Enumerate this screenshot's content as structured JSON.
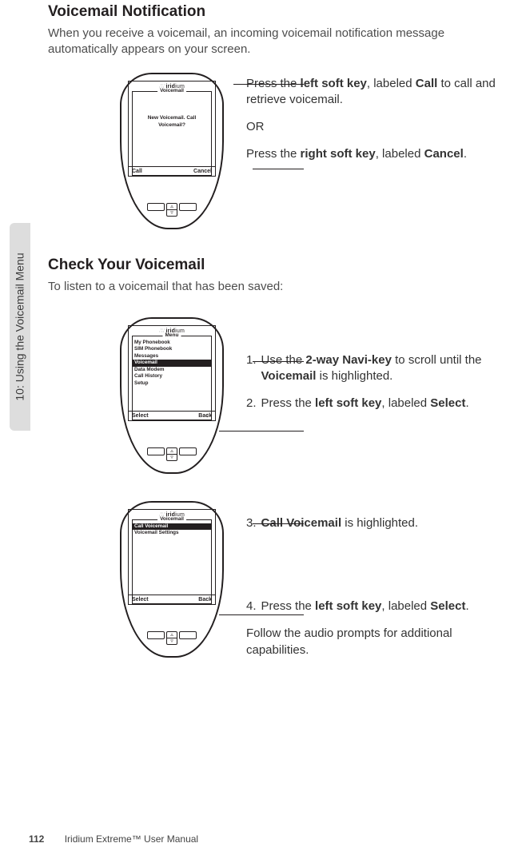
{
  "side_tab": "10: Using the Voicemail Menu",
  "section1": {
    "title": "Voicemail Notification",
    "intro": "When you receive a voicemail, an incoming voicemail notification message automatically appears on your screen.",
    "instr1_pre": "Press the ",
    "instr1_bold1": "left soft key",
    "instr1_mid": ", labeled ",
    "instr1_bold2": "Call",
    "instr1_post": " to call and retrieve voicemail.",
    "or": "OR",
    "instr2_pre": "Press the ",
    "instr2_bold1": "right soft key",
    "instr2_mid": ", labeled ",
    "instr2_bold2": "Cancel",
    "instr2_post": "."
  },
  "phone1": {
    "brand_word1": "irid",
    "brand_word2": "ium",
    "legend": "Voicemail",
    "prompt_l1": "New Voicemail. Call",
    "prompt_l2": "Voicemail?",
    "left_soft": "Call",
    "right_soft": "Cancel"
  },
  "section2": {
    "title": "Check Your Voicemail",
    "intro": "To listen to a voicemail that has been saved:",
    "step1_num": "1.",
    "step1_pre": "Use the ",
    "step1_bold1": "2-way Navi-key",
    "step1_mid": " to scroll until the ",
    "step1_bold2": "Voicemail",
    "step1_post": " is highlighted.",
    "step2_num": "2.",
    "step2_pre": "Press the ",
    "step2_bold1": "left soft key",
    "step2_mid": ", labeled ",
    "step2_bold2": "Select",
    "step2_post": ".",
    "step3_num": "3.",
    "step3_bold": "Call Voicemail",
    "step3_post": " is highlighted.",
    "step4_num": "4.",
    "step4_pre": "Press the ",
    "step4_bold1": "left soft key",
    "step4_mid": ", labeled ",
    "step4_bold2": "Select",
    "step4_post": ".",
    "followup": "Follow the audio prompts for additional capabilities."
  },
  "phone2": {
    "legend": "Menu",
    "items": [
      "My Phonebook",
      "SIM Phonebook",
      "Messages",
      "Voicemail",
      "Data Modem",
      "Call History",
      "Setup"
    ],
    "highlight_index": 3,
    "left_soft": "Select",
    "right_soft": "Back",
    "arrow": "↓"
  },
  "phone3": {
    "legend": "Voicemail",
    "items": [
      "Call Voicemail",
      "Voicemail Settings"
    ],
    "highlight_index": 0,
    "left_soft": "Select",
    "right_soft": "Back"
  },
  "footer": {
    "page_number": "112",
    "book": "Iridium Extreme™ User Manual"
  }
}
